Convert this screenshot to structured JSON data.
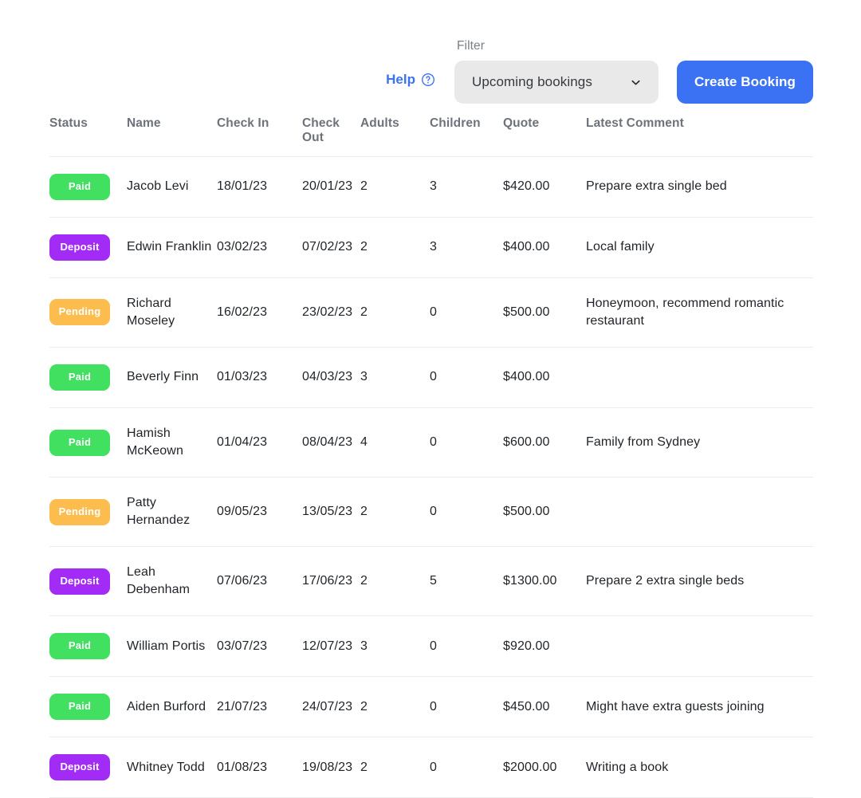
{
  "toolbar": {
    "help_label": "Help",
    "help_icon": "question-circle-icon",
    "filter_label": "Filter",
    "filter_value": "Upcoming bookings",
    "filter_options": [
      "Upcoming bookings"
    ],
    "chevron_icon": "chevron-down-icon",
    "create_button_label": "Create Booking",
    "accent_color": "#3b72f4",
    "filter_bg_color": "#e9e9ea"
  },
  "table": {
    "columns": [
      {
        "key": "status",
        "label": "Status"
      },
      {
        "key": "name",
        "label": "Name"
      },
      {
        "key": "check_in",
        "label": "Check In"
      },
      {
        "key": "check_out",
        "label": "Check Out"
      },
      {
        "key": "adults",
        "label": "Adults"
      },
      {
        "key": "children",
        "label": "Children"
      },
      {
        "key": "quote",
        "label": "Quote"
      },
      {
        "key": "comment",
        "label": "Latest Comment"
      }
    ],
    "status_colors": {
      "Paid": "#41e061",
      "Deposit": "#a22cf5",
      "Pending": "#fcbc4e"
    },
    "rows": [
      {
        "status": "Paid",
        "name": "Jacob Levi",
        "check_in": "18/01/23",
        "check_out": "20/01/23",
        "adults": "2",
        "children": "3",
        "quote": "$420.00",
        "comment": "Prepare extra single bed"
      },
      {
        "status": "Deposit",
        "name": "Edwin Franklin",
        "check_in": "03/02/23",
        "check_out": "07/02/23",
        "adults": "2",
        "children": "3",
        "quote": "$400.00",
        "comment": "Local family"
      },
      {
        "status": "Pending",
        "name": "Richard Moseley",
        "check_in": "16/02/23",
        "check_out": "23/02/23",
        "adults": "2",
        "children": "0",
        "quote": "$500.00",
        "comment": "Honeymoon, recommend romantic restaurant"
      },
      {
        "status": "Paid",
        "name": "Beverly Finn",
        "check_in": "01/03/23",
        "check_out": "04/03/23",
        "adults": "3",
        "children": "0",
        "quote": "$400.00",
        "comment": ""
      },
      {
        "status": "Paid",
        "name": "Hamish McKeown",
        "check_in": "01/04/23",
        "check_out": "08/04/23",
        "adults": "4",
        "children": "0",
        "quote": "$600.00",
        "comment": "Family from Sydney"
      },
      {
        "status": "Pending",
        "name": "Patty Hernandez",
        "check_in": "09/05/23",
        "check_out": "13/05/23",
        "adults": "2",
        "children": "0",
        "quote": "$500.00",
        "comment": ""
      },
      {
        "status": "Deposit",
        "name": "Leah Debenham",
        "check_in": "07/06/23",
        "check_out": "17/06/23",
        "adults": "2",
        "children": "5",
        "quote": "$1300.00",
        "comment": "Prepare 2 extra single beds"
      },
      {
        "status": "Paid",
        "name": "William Portis",
        "check_in": "03/07/23",
        "check_out": "12/07/23",
        "adults": "3",
        "children": "0",
        "quote": "$920.00",
        "comment": ""
      },
      {
        "status": "Paid",
        "name": "Aiden Burford",
        "check_in": "21/07/23",
        "check_out": "24/07/23",
        "adults": "2",
        "children": "0",
        "quote": "$450.00",
        "comment": "Might have extra guests joining"
      },
      {
        "status": "Deposit",
        "name": "Whitney Todd",
        "check_in": "01/08/23",
        "check_out": "19/08/23",
        "adults": "2",
        "children": "0",
        "quote": "$2000.00",
        "comment": "Writing a book"
      }
    ]
  }
}
